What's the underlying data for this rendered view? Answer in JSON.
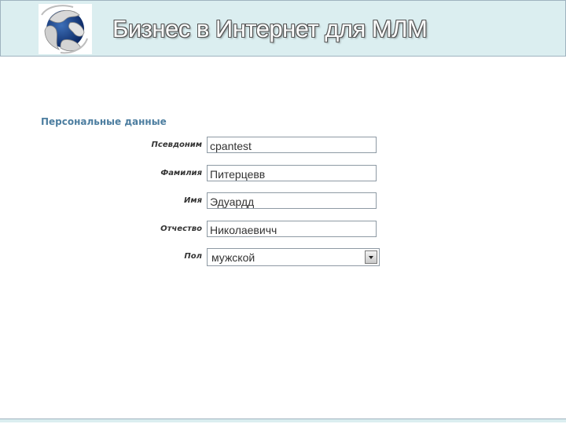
{
  "header": {
    "title": "Бизнес в Интернет для МЛМ",
    "logo_icon": "globe-icon"
  },
  "form": {
    "section_title": "Персональные данные",
    "fields": [
      {
        "label": "Псевдоним",
        "value": "cpantest"
      },
      {
        "label": "Фамилия",
        "value": "Питерцевв"
      },
      {
        "label": "Имя",
        "value": "Эдуардд"
      },
      {
        "label": "Отчество",
        "value": "Николаевичч"
      }
    ],
    "gender": {
      "label": "Пол",
      "value": "мужской"
    }
  },
  "colors": {
    "header_bg": "#dbeef0",
    "section_title": "#4d7ea0",
    "border": "#8e9aa4"
  }
}
